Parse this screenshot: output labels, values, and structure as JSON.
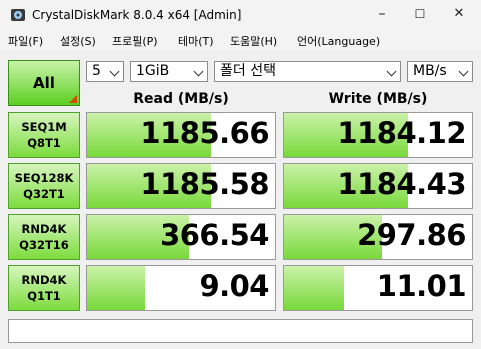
{
  "window": {
    "title": "CrystalDiskMark 8.0.4 x64 [Admin]",
    "minimize": "–",
    "maximize": "☐",
    "close": "✕"
  },
  "menu": [
    {
      "label": "파일(F)"
    },
    {
      "label": "설정(S)"
    },
    {
      "label": "프로필(P)"
    },
    {
      "label": "테마(T)"
    },
    {
      "label": "도움말(H)"
    },
    {
      "label": "언어(Language)"
    }
  ],
  "controls": {
    "all_label": "All",
    "count": "5",
    "size": "1GiB",
    "target": "폴더 선택",
    "unit": "MB/s"
  },
  "headers": {
    "read": "Read (MB/s)",
    "write": "Write (MB/s)"
  },
  "rows": [
    {
      "line1": "SEQ1M",
      "line2": "Q8T1",
      "read": "1185.66",
      "write": "1184.12",
      "read_fill": 0.66,
      "write_fill": 0.66
    },
    {
      "line1": "SEQ128K",
      "line2": "Q32T1",
      "read": "1185.58",
      "write": "1184.43",
      "read_fill": 0.66,
      "write_fill": 0.66
    },
    {
      "line1": "RND4K",
      "line2": "Q32T16",
      "read": "366.54",
      "write": "297.86",
      "read_fill": 0.54,
      "write_fill": 0.52
    },
    {
      "line1": "RND4K",
      "line2": "Q1T1",
      "read": "9.04",
      "write": "11.01",
      "read_fill": 0.31,
      "write_fill": 0.32
    }
  ],
  "status_text": "",
  "colors": {
    "accent_green": "#78d93a",
    "corner_orange": "#d04a00"
  }
}
